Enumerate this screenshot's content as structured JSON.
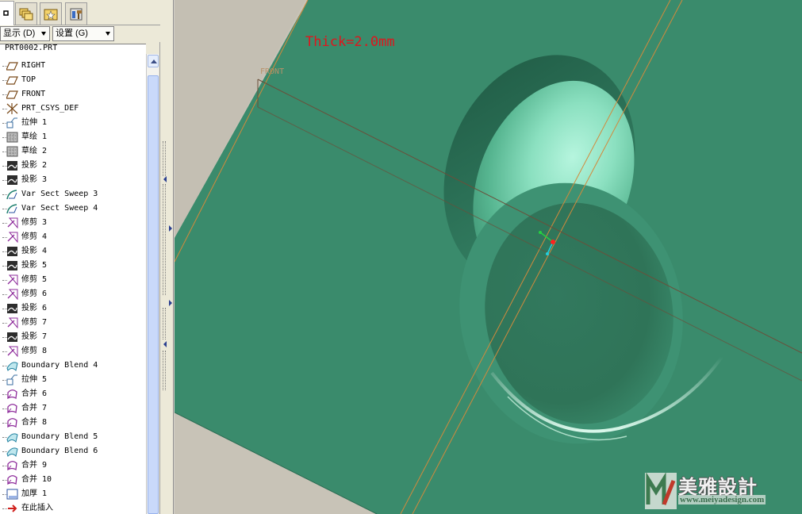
{
  "toolbar": {
    "tabs": [
      {
        "icon": "model-tree-icon",
        "active": true
      },
      {
        "icon": "folder-browser-icon",
        "active": false
      },
      {
        "icon": "favorites-icon",
        "active": false
      },
      {
        "icon": "connections-icon",
        "active": false
      }
    ],
    "show_menu": "显示 (D)",
    "settings_menu": "设置 (G)"
  },
  "tree": {
    "root": "PRT0002.PRT",
    "items": [
      {
        "label": "RIGHT",
        "icon": "datum-plane-icon"
      },
      {
        "label": "TOP",
        "icon": "datum-plane-icon"
      },
      {
        "label": "FRONT",
        "icon": "datum-plane-icon"
      },
      {
        "label": "PRT_CSYS_DEF",
        "icon": "csys-icon"
      },
      {
        "label": "拉伸 1",
        "icon": "extrude-icon"
      },
      {
        "label": "草绘 1",
        "icon": "sketch-icon"
      },
      {
        "label": "草绘 2",
        "icon": "sketch-icon"
      },
      {
        "label": "投影 2",
        "icon": "projection-icon"
      },
      {
        "label": "投影 3",
        "icon": "projection-icon"
      },
      {
        "label": "Var Sect Sweep 3",
        "icon": "sweep-icon"
      },
      {
        "label": "Var Sect Sweep 4",
        "icon": "sweep-icon"
      },
      {
        "label": "修剪 3",
        "icon": "trim-icon"
      },
      {
        "label": "修剪 4",
        "icon": "trim-icon"
      },
      {
        "label": "投影 4",
        "icon": "projection-icon"
      },
      {
        "label": "投影 5",
        "icon": "projection-icon"
      },
      {
        "label": "修剪 5",
        "icon": "trim-icon"
      },
      {
        "label": "修剪 6",
        "icon": "trim-icon"
      },
      {
        "label": "投影 6",
        "icon": "projection-icon"
      },
      {
        "label": "修剪 7",
        "icon": "trim-icon"
      },
      {
        "label": "投影 7",
        "icon": "projection-icon"
      },
      {
        "label": "修剪 8",
        "icon": "trim-icon"
      },
      {
        "label": "Boundary Blend 4",
        "icon": "boundary-blend-icon"
      },
      {
        "label": "拉伸 5",
        "icon": "extrude-icon"
      },
      {
        "label": "合并 6",
        "icon": "merge-icon"
      },
      {
        "label": "合并 7",
        "icon": "merge-icon"
      },
      {
        "label": "合并 8",
        "icon": "merge-icon"
      },
      {
        "label": "Boundary Blend 5",
        "icon": "boundary-blend-icon"
      },
      {
        "label": "Boundary Blend 6",
        "icon": "boundary-blend-icon"
      },
      {
        "label": "合并 9",
        "icon": "merge-icon"
      },
      {
        "label": "合并 10",
        "icon": "merge-icon"
      },
      {
        "label": "加厚 1",
        "icon": "thicken-icon"
      },
      {
        "label": "在此插入",
        "icon": "insert-here-icon"
      }
    ]
  },
  "viewport": {
    "annotation": "Thick=2.0mm",
    "datum_tag": "FRONT",
    "colors": {
      "surface": "#3a8b6c",
      "background": "#c8c3b7",
      "annotation": "#e0151c",
      "datum_edge": "#d28a3c"
    }
  },
  "watermark": {
    "title": "美雅設計",
    "url": "www.meiyadesign.com"
  }
}
